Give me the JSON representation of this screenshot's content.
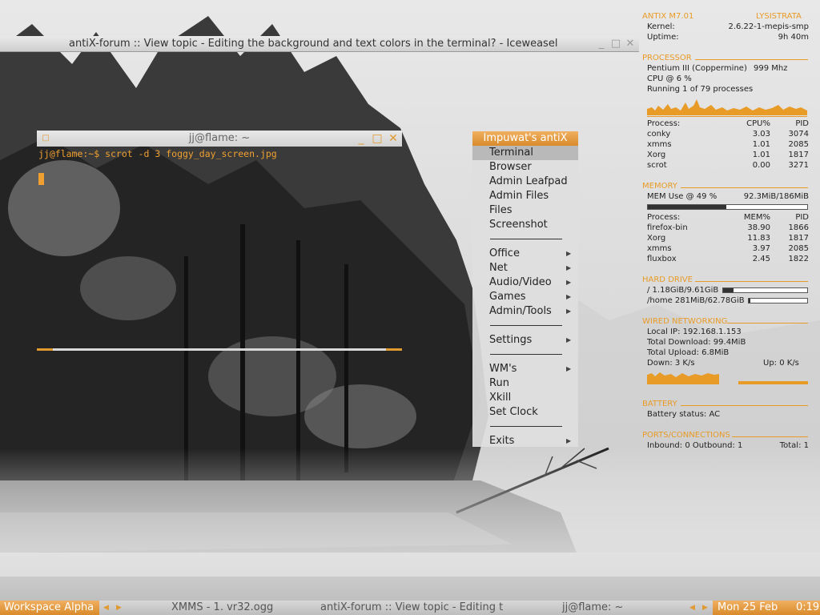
{
  "browser": {
    "title": "antiX-forum :: View topic - Editing the background and text colors in the terminal? - Iceweasel",
    "minimize_glyph": "_",
    "maximize_glyph": "□",
    "close_glyph": "✕"
  },
  "terminal": {
    "title": "jj@flame: ~",
    "command_line": "jj@flame:~$ scrot -d 3 foggy_day_screen.jpg",
    "menu_glyph": "□",
    "minimize_glyph": "_",
    "maximize_glyph": "□",
    "close_glyph": "✕"
  },
  "menu": {
    "title": "Impuwat's antiX",
    "items": [
      {
        "label": "Terminal",
        "submenu": false,
        "selected": true
      },
      {
        "label": "Browser",
        "submenu": false
      },
      {
        "label": "Admin Leafpad",
        "submenu": false
      },
      {
        "label": "Admin Files",
        "submenu": false
      },
      {
        "label": "Files",
        "submenu": false
      },
      {
        "label": "Screenshot",
        "submenu": false
      },
      {
        "label": "Office",
        "submenu": true
      },
      {
        "label": "Net",
        "submenu": true
      },
      {
        "label": "Audio/Video",
        "submenu": true
      },
      {
        "label": "Games",
        "submenu": true
      },
      {
        "label": "Admin/Tools",
        "submenu": true
      },
      {
        "label": "Settings",
        "submenu": true
      },
      {
        "label": "WM's",
        "submenu": true
      },
      {
        "label": "Run",
        "submenu": false
      },
      {
        "label": "Xkill",
        "submenu": false
      },
      {
        "label": "Set Clock",
        "submenu": false
      },
      {
        "label": "Exits",
        "submenu": true
      }
    ],
    "arrow_glyph": "▶"
  },
  "conky": {
    "distro": "ANTIX M7.01",
    "host": "LYSISTRATA",
    "kernel_label": "Kernel:",
    "kernel_value": "2.6.22-1-mepis-smp",
    "uptime_label": "Uptime:",
    "uptime_value": "9h 40m",
    "processor_head": "PROCESSOR",
    "cpu_name": "Pentium III (Coppermine)",
    "cpu_mhz": "999  Mhz",
    "cpu_usage": "CPU @ 6  %",
    "running": "Running 1 of 79  processes",
    "cpu_table_headers": [
      "Process:",
      "CPU%",
      "PID"
    ],
    "cpu_rows": [
      [
        "conky",
        "3.03",
        "3074"
      ],
      [
        "xmms",
        "1.01",
        "2085"
      ],
      [
        "Xorg",
        "1.01",
        "1817"
      ],
      [
        "scrot",
        "0.00",
        "3271"
      ]
    ],
    "memory_head": "MEMORY",
    "mem_use": "MEM Use @ 49 %",
    "mem_amount": "92.3MiB/186MiB",
    "mem_percent": 49,
    "mem_table_headers": [
      "Process:",
      "MEM%",
      "PID"
    ],
    "mem_rows": [
      [
        "firefox-bin",
        "38.90",
        "1866"
      ],
      [
        "Xorg",
        "11.83",
        "1817"
      ],
      [
        "xmms",
        "3.97",
        "2085"
      ],
      [
        "fluxbox",
        "2.45",
        "1822"
      ]
    ],
    "disk_head": "HARD DRIVE",
    "disk_root": "/   1.18GiB/9.61GiB",
    "disk_root_fraction": 0.12,
    "disk_home": "/home   281MiB/62.78GiB",
    "disk_home_fraction": 0.01,
    "net_head": "WIRED NETWORKING",
    "local_ip": "Local IP:  192.168.1.153",
    "total_down": "Total Download:  99.4MiB",
    "total_up": "Total Upload:  6.8MiB",
    "down_rate": "Down:  3    K/s",
    "up_rate": "Up:  0    K/s",
    "battery_head": "BATTERY",
    "battery_status": "Battery status: AC",
    "ports_head": "PORTS/CONNECTIONS",
    "ports_inout": "Inbound: 0   Outbound: 1",
    "ports_total": "Total: 1"
  },
  "taskbar": {
    "workspace": "Workspace Alpha",
    "tasks": [
      "XMMS - 1. vr32.ogg",
      "antiX-forum :: View topic - Editing t",
      "jj@flame: ~"
    ],
    "date": "Mon 25 Feb",
    "time": "0:19",
    "prev_glyph": "◀",
    "next_glyph": "▶"
  },
  "colors": {
    "accent": "#e89b27",
    "menu_bg": "#dedede",
    "taskbar_bg": "#c8c8c8"
  }
}
